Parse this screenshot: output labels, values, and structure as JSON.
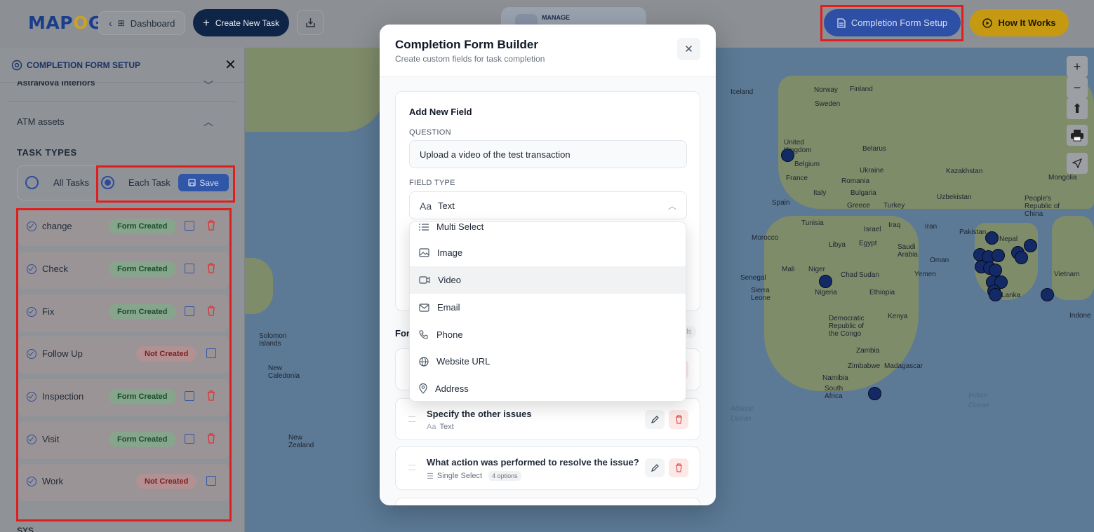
{
  "header": {
    "logo_text": "MAPOG",
    "dashboard_label": "Dashboard",
    "create_task_label": "Create New Task",
    "manage_label": "MANAGE",
    "completion_form_setup_label": "Completion Form Setup",
    "how_it_works_label": "How It Works"
  },
  "sidebar": {
    "title": "COMPLETION FORM SETUP",
    "previous_group": "AstraNova Interiors",
    "group_name": "ATM assets",
    "task_types_heading": "TASK TYPES",
    "radio_all_tasks": "All Tasks",
    "radio_each_task": "Each Task",
    "selected_radio": "Each Task",
    "save_label": "Save",
    "tasks": [
      {
        "name": "change",
        "status": "Form Created"
      },
      {
        "name": "Check",
        "status": "Form Created"
      },
      {
        "name": "Fix",
        "status": "Form Created"
      },
      {
        "name": "Follow Up",
        "status": "Not Created"
      },
      {
        "name": "Inspection",
        "status": "Form Created"
      },
      {
        "name": "Visit",
        "status": "Form Created"
      },
      {
        "name": "Work",
        "status": "Not Created"
      }
    ],
    "next_group": "SYS"
  },
  "modal": {
    "title": "Completion Form Builder",
    "subtitle": "Create custom fields for task completion",
    "add_field": {
      "title": "Add New Field",
      "question_label": "QUESTION",
      "question_value": "Upload a video of the test transaction",
      "field_type_label": "FIELD TYPE",
      "field_type_icon": "Aa",
      "field_type_value": "Text"
    },
    "field_type_options": [
      {
        "label": "Multi Select",
        "icon": "list-icon"
      },
      {
        "label": "Image",
        "icon": "image-icon"
      },
      {
        "label": "Video",
        "icon": "video-icon"
      },
      {
        "label": "Email",
        "icon": "mail-icon"
      },
      {
        "label": "Phone",
        "icon": "phone-icon"
      },
      {
        "label": "Website URL",
        "icon": "globe-icon"
      },
      {
        "label": "Address",
        "icon": "pin-icon"
      }
    ],
    "hovered_option": "Video",
    "form_fields_heading": "For",
    "form_fields_count": "ds",
    "fields": [
      {
        "question": "Specify the other issues",
        "type": "Text",
        "type_icon": "Aa",
        "options": ""
      },
      {
        "question": "What action was performed to resolve the issue?",
        "type": "Single Select",
        "type_icon": "☰",
        "options": "4 options"
      }
    ]
  },
  "map": {
    "labels": [
      "Iceland",
      "Norway",
      "Finland",
      "Sweden",
      "United Kingdom",
      "Belgium",
      "Belarus",
      "Ukraine",
      "France",
      "Romania",
      "Kazakhstan",
      "Mongolia",
      "Italy",
      "Bulgaria",
      "Spain",
      "Greece",
      "Turkey",
      "Uzbekistan",
      "People's Republic of China",
      "Tunisia",
      "Israel",
      "Iraq",
      "Iran",
      "Pakistan",
      "Nepal",
      "Morocco",
      "Libya",
      "Egypt",
      "Saudi Arabia",
      "Oman",
      "Mali",
      "Niger",
      "Chad",
      "Sudan",
      "Yemen",
      "Senegal",
      "Nigeria",
      "Ethiopia",
      "Sierra Leone",
      "Vietnam",
      "Democratic Republic of the Congo",
      "Kenya",
      "Zambia",
      "Zimbabwe",
      "Madagascar",
      "Namibia",
      "South Africa",
      "Solomon Islands",
      "New Caledonia",
      "New Zealand",
      "Atlantic Ocean",
      "Indian Ocean",
      "Sri Lanka",
      "Indone"
    ],
    "pin_color": "#142a66"
  },
  "colors": {
    "primary": "#2e4fa6",
    "accent_yellow": "#c59a12",
    "highlight_red": "#e01e1e",
    "created_green": "#1a4d2a",
    "not_created_red": "#7a1f22"
  }
}
